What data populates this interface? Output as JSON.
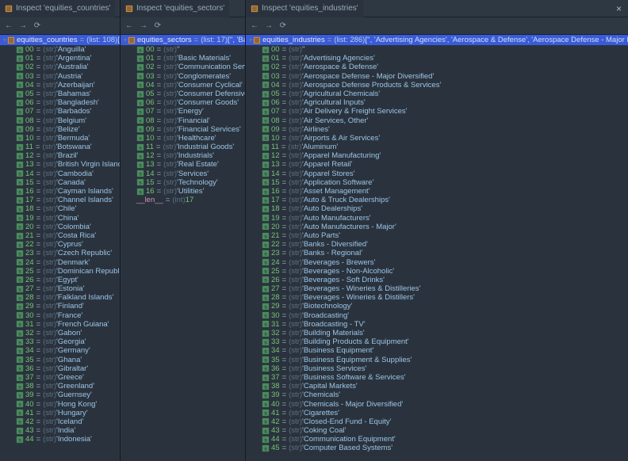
{
  "panes": [
    {
      "title": "Inspect 'equities_countries'",
      "var": "equities_countries",
      "len": 108,
      "preview": "['Angu",
      "show_close": false,
      "items": [
        "Anguilla",
        "Argentina",
        "Australia",
        "Austria",
        "Azerbaijan",
        "Bahamas",
        "Bangladesh",
        "Barbados",
        "Belgium",
        "Belize",
        "Bermuda",
        "Botswana",
        "Brazil",
        "British Virgin Islands",
        "Cambodia",
        "Canada",
        "Cayman Islands",
        "Channel Islands",
        "Chile",
        "China",
        "Colombia",
        "Costa Rica",
        "Cyprus",
        "Czech Republic",
        "Denmark",
        "Dominican Republic",
        "Egypt",
        "Estonia",
        "Falkland Islands",
        "Finland",
        "France",
        "French Guiana",
        "Gabon",
        "Georgia",
        "Germany",
        "Ghana",
        "Gibraltar",
        "Greece",
        "Greenland",
        "Guernsey",
        "Hong Kong",
        "Hungary",
        "Iceland",
        "India",
        "Indonesia"
      ]
    },
    {
      "title": "Inspect 'equities_sectors'",
      "var": "equities_sectors",
      "len": 17,
      "preview": "['', 'Basic Materi",
      "show_close": false,
      "items": [
        "",
        "Basic Materials",
        "Communication Services",
        "Conglomerates",
        "Consumer Cyclical",
        "Consumer Defensive",
        "Consumer Goods",
        "Energy",
        "Financial",
        "Financial Services",
        "Healthcare",
        "Industrial Goods",
        "Industrials",
        "Real Estate",
        "Services",
        "Technology",
        "Utilities"
      ],
      "show_len_row": true
    },
    {
      "title": "Inspect 'equities_industries'",
      "var": "equities_industries",
      "len": 286,
      "preview": "['', 'Advertising Agencies', 'Aerospace & Defense', 'Aerospace Defense - Major Diversified', 'Aerospace Defense Pr…View",
      "show_close": true,
      "items": [
        "",
        "Advertising Agencies",
        "Aerospace & Defense",
        "Aerospace Defense - Major Diversified",
        "Aerospace Defense Products & Services",
        "Agricultural Chemicals",
        "Agricultural Inputs",
        "Air Delivery & Freight Services",
        "Air Services, Other",
        "Airlines",
        "Airports & Air Services",
        "Aluminum",
        "Apparel Manufacturing",
        "Apparel Retail",
        "Apparel Stores",
        "Application Software",
        "Asset Management",
        "Auto & Truck Dealerships",
        "Auto Dealerships",
        "Auto Manufacturers",
        "Auto Manufacturers - Major",
        "Auto Parts",
        "Banks - Diversified",
        "Banks - Regional",
        "Beverages - Brewers",
        "Beverages - Non-Alcoholic",
        "Beverages - Soft Drinks",
        "Beverages - Wineries & Distilleries",
        "Beverages - Wineries & Distillers",
        "Biotechnology",
        "Broadcasting",
        "Broadcasting - TV",
        "Building Materials",
        "Building Products & Equipment",
        "Business Equipment",
        "Business Equipment & Supplies",
        "Business Services",
        "Business Software & Services",
        "Capital Markets",
        "Chemicals",
        "Chemicals - Major Diversified",
        "Cigarettes",
        "Closed-End Fund - Equity",
        "Coking Coal",
        "Communication Equipment",
        "Computer Based Systems"
      ]
    }
  ],
  "type_label": "(str)",
  "list_type_str": "(list:",
  "len_label": "__len__",
  "int_label": "(int)"
}
